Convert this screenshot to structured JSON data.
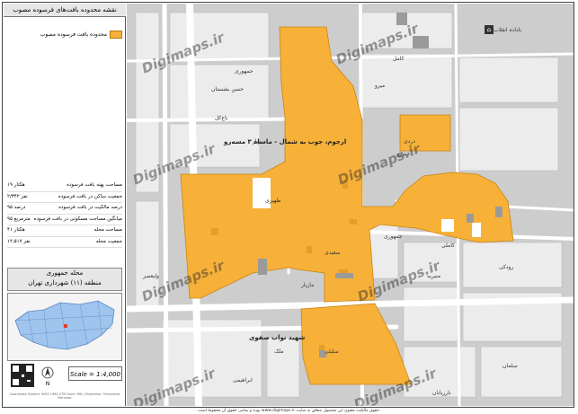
{
  "panel": {
    "title": "نقشه محدوده بافت‌های فرسوده مصوب",
    "legend_label": "محدوده بافت فرسوده مصوب",
    "legend_color": "#f7b139",
    "stats": [
      {
        "label": "مساحت پهنه بافت فرسوده",
        "value": "۱۹ هکتار"
      },
      {
        "label": "جمعیت ساکن در بافت فرسوده",
        "value": "۲/۳۴۲ نفر"
      },
      {
        "label": "درصد مالکیت در بافت فرسوده",
        "value": "۹۵ درصد"
      },
      {
        "label": "میانگین مساحت مسکونی در بافت فرسوده",
        "value": "۹۵ مترمربع"
      },
      {
        "label": "مساحت محله",
        "value": "۴۱ هکتار"
      },
      {
        "label": "جمعیت محله",
        "value": "۱۲,۵۱۷ نفر"
      }
    ],
    "location_line1": "محله جمهوری",
    "location_line2": "منطقه (۱۱) شهرداری تهران",
    "scale": "Scale = 1:4,000",
    "north": "N",
    "footnote": "Coordinate System: WGS 1984 UTM Zone 39N | Projection: Transverse Mercator"
  },
  "map": {
    "callout": "ارجوم، جوب به شمال - ماساه ۳ مسه‌رو",
    "labels": [
      "باداده انقلاب",
      "کامل",
      "جمهوری",
      "حسن بشستان",
      "میرو",
      "باغ‌کل",
      "بهار",
      "ظهیری",
      "دردی",
      "خسرو",
      "جمهوری",
      "کاملی",
      "رودکی",
      "منیریه",
      "مازیار",
      "ولیعصر",
      "سعیدی",
      "شهید نواب صفوی",
      "ملک",
      "سلبلی",
      "سلمان",
      "بارزیابان",
      "ابراهیمی"
    ],
    "watermark": "Digimaps.ir"
  },
  "footer": "حقوق مالکیت معنوی این محصول متعلق به سایت www.digimaps.ir بوده و تمامی حقوق آن محفوظ است."
}
